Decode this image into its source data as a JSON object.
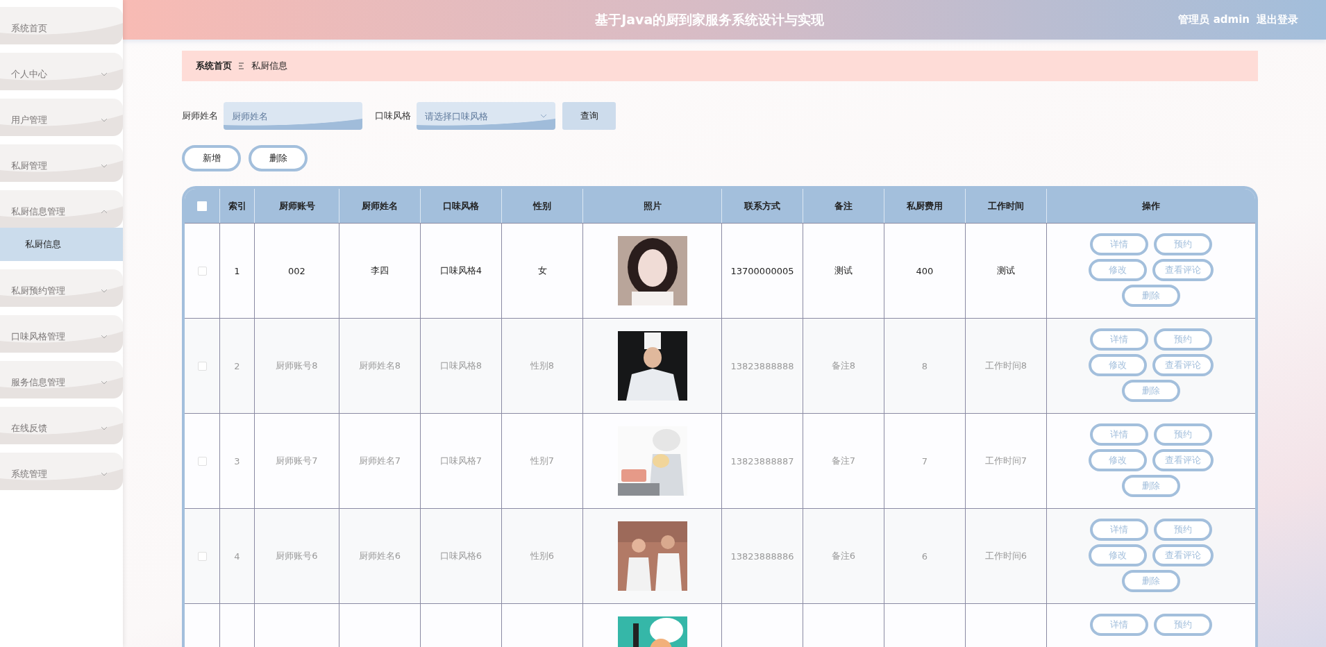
{
  "header": {
    "title": "基于Java的厨到家服务系统设计与实现",
    "user": "管理员 admin",
    "logout": "退出登录"
  },
  "sidebar": {
    "items": [
      {
        "label": "系统首页",
        "kind": "link"
      },
      {
        "label": "个人中心",
        "kind": "menu",
        "expanded": false
      },
      {
        "label": "用户管理",
        "kind": "menu",
        "expanded": false
      },
      {
        "label": "私厨管理",
        "kind": "menu",
        "expanded": false
      },
      {
        "label": "私厨信息管理",
        "kind": "menu",
        "expanded": true,
        "children": [
          {
            "label": "私厨信息",
            "selected": true
          }
        ]
      },
      {
        "label": "私厨预约管理",
        "kind": "menu",
        "expanded": false
      },
      {
        "label": "口味风格管理",
        "kind": "menu",
        "expanded": false
      },
      {
        "label": "服务信息管理",
        "kind": "menu",
        "expanded": false
      },
      {
        "label": "在线反馈",
        "kind": "menu",
        "expanded": false
      },
      {
        "label": "系统管理",
        "kind": "menu",
        "expanded": false
      }
    ]
  },
  "breadcrumb": [
    {
      "label": "系统首页",
      "current": false
    },
    {
      "label": "私厨信息",
      "current": true
    }
  ],
  "search": {
    "fields": [
      {
        "label": "厨师姓名",
        "placeholder": "厨师姓名",
        "kind": "input"
      },
      {
        "label": "口味风格",
        "placeholder": "请选择口味风格",
        "kind": "select"
      }
    ],
    "button": "查询"
  },
  "actions": [
    "新增",
    "删除"
  ],
  "table": {
    "select_all": {
      "checked": false
    },
    "columns": [
      "索引",
      "厨师账号",
      "厨师姓名",
      "口味风格",
      "性别",
      "照片",
      "联系方式",
      "备注",
      "私厨费用",
      "工作时间",
      "操作"
    ],
    "rows": [
      {
        "checked": false,
        "muted": false,
        "index": "1",
        "account": "002",
        "name": "李四",
        "taste": "口味风格4",
        "gender": "女",
        "phone": "13700000005",
        "note": "测试",
        "fee": "400",
        "work_time": "测试",
        "actions": [
          "详情",
          "预约",
          "修改",
          "查看评论",
          "删除"
        ]
      },
      {
        "checked": false,
        "muted": true,
        "index": "2",
        "account": "厨师账号8",
        "name": "厨师姓名8",
        "taste": "口味风格8",
        "gender": "性别8",
        "phone": "13823888888",
        "note": "备注8",
        "fee": "8",
        "work_time": "工作时间8",
        "actions": [
          "详情",
          "预约",
          "修改",
          "查看评论",
          "删除"
        ]
      },
      {
        "checked": false,
        "muted": true,
        "index": "3",
        "account": "厨师账号7",
        "name": "厨师姓名7",
        "taste": "口味风格7",
        "gender": "性别7",
        "phone": "13823888887",
        "note": "备注7",
        "fee": "7",
        "work_time": "工作时间7",
        "actions": [
          "详情",
          "预约",
          "修改",
          "查看评论",
          "删除"
        ]
      },
      {
        "checked": false,
        "muted": true,
        "index": "4",
        "account": "厨师账号6",
        "name": "厨师姓名6",
        "taste": "口味风格6",
        "gender": "性别6",
        "phone": "13823888886",
        "note": "备注6",
        "fee": "6",
        "work_time": "工作时间6",
        "actions": [
          "详情",
          "预约",
          "修改",
          "查看评论",
          "删除"
        ]
      },
      {
        "actions": [
          "详情",
          "预约"
        ]
      }
    ]
  }
}
